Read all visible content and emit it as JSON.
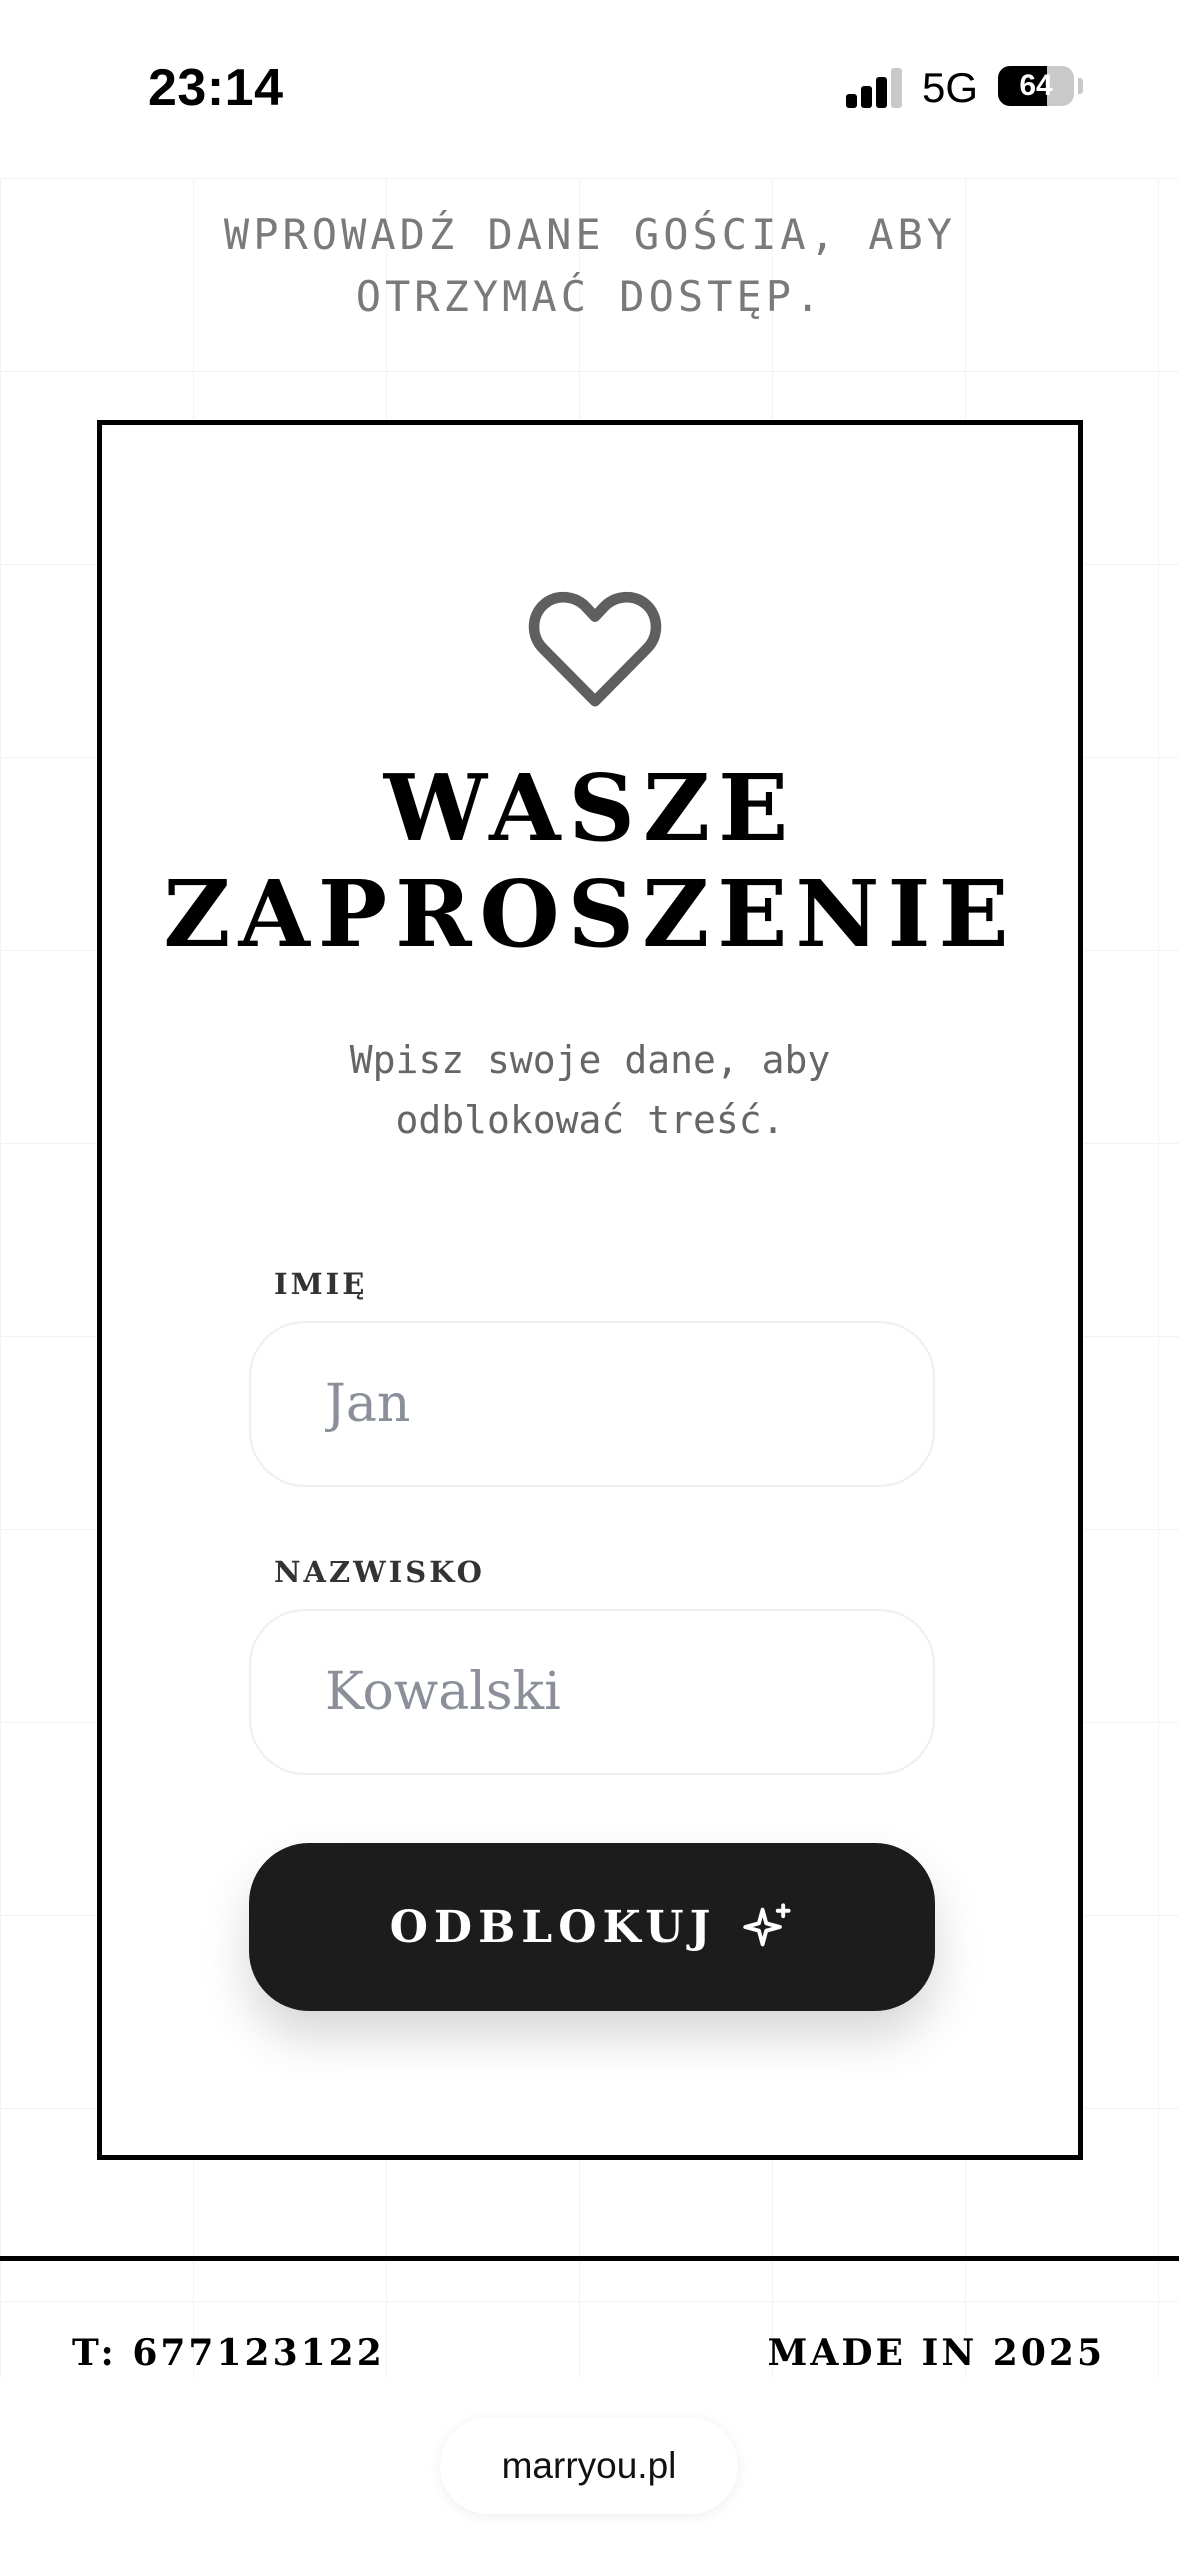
{
  "status_bar": {
    "time": "23:14",
    "network": "5G",
    "battery_level": "64",
    "battery_fraction": 0.64
  },
  "instruction": "WPROWADŹ DANE GOŚCIA, ABY OTRZYMAĆ DOSTĘP.",
  "card": {
    "icon": "heart-icon",
    "title_line1": "WASZE",
    "title_line2": "ZAPROSZENIE",
    "subtitle": "Wpisz swoje dane, aby odblokować treść.",
    "first_name": {
      "label": "IMIĘ",
      "placeholder": "Jan",
      "value": ""
    },
    "last_name": {
      "label": "NAZWISKO",
      "placeholder": "Kowalski",
      "value": ""
    },
    "button": {
      "label": "ODBLOKUJ",
      "icon": "sparkle-icon"
    }
  },
  "footer": {
    "phone": "T: 677123122",
    "made_in": "MADE IN 2025"
  },
  "browser": {
    "url": "marryou.pl"
  },
  "colors": {
    "background": "#ffffff",
    "border": "#000000",
    "button": "#1c1c1c",
    "muted_text": "#7a7a7a",
    "heart_stroke": "#5f5f5f"
  }
}
